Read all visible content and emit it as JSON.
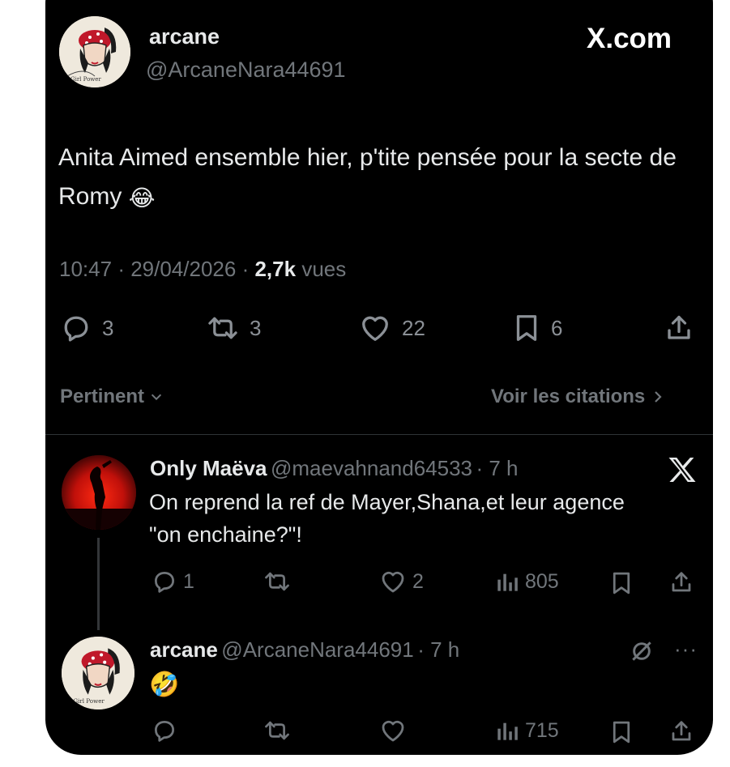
{
  "brand": "X.com",
  "post": {
    "author_name": "arcane",
    "author_handle": "@ArcaneNara44691",
    "text": "Anita Aimed ensemble hier, p'tite pensée pour la secte de Romy",
    "emoji": "😂",
    "time": "10:47",
    "date": "29/04/2026",
    "views_count": "2,7k",
    "views_label": "vues",
    "stats": {
      "replies": "3",
      "reposts": "3",
      "likes": "22",
      "bookmarks": "6"
    },
    "sort_label": "Pertinent",
    "quotes_label": "Voir les citations"
  },
  "replies": [
    {
      "name": "Only Maëva",
      "handle": "@maevahnand64533",
      "time": "7 h",
      "text": "On reprend la ref de Mayer,Shana,et leur agence \"on enchaine?\"!",
      "replies": "1",
      "likes": "2",
      "views": "805"
    },
    {
      "name": "arcane",
      "handle": "@ArcaneNara44691",
      "time": "7 h",
      "emoji": "🤣",
      "views": "715"
    }
  ],
  "colors": {
    "background": "#000000",
    "text": "#e7e9ea",
    "muted": "#71767b",
    "divider": "#2f3336"
  }
}
